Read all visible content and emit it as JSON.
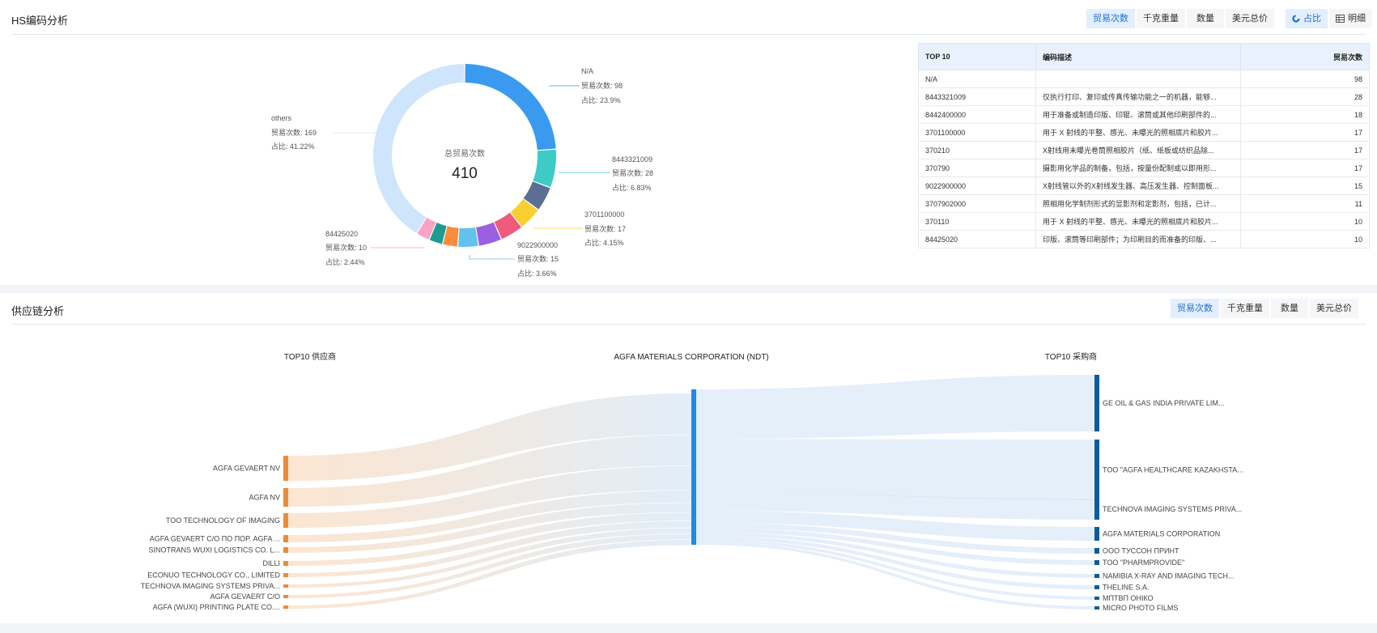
{
  "hs_section": {
    "title": "HS编码分析",
    "metric_buttons": [
      "贸易次数",
      "千克重量",
      "数量",
      "美元总价"
    ],
    "view_buttons": [
      "占比",
      "明细"
    ],
    "donut_center": {
      "label": "总贸易次数",
      "value": "410"
    },
    "donut_labels": [
      {
        "code": "N/A",
        "count": "贸易次数: 98",
        "pct": "占比: 23.9%"
      },
      {
        "code": "8443321009",
        "count": "贸易次数: 28",
        "pct": "占比: 6.83%"
      },
      {
        "code": "3701100000",
        "count": "贸易次数: 17",
        "pct": "占比: 4.15%"
      },
      {
        "code": "9022900000",
        "count": "贸易次数: 15",
        "pct": "占比: 3.66%"
      },
      {
        "code": "84425020",
        "count": "贸易次数: 10",
        "pct": "占比: 2.44%"
      },
      {
        "code": "others",
        "count": "贸易次数: 169",
        "pct": "占比: 41.22%"
      }
    ],
    "table": {
      "headers": [
        "TOP 10",
        "编码描述",
        "贸易次数"
      ],
      "rows": [
        [
          "N/A",
          "",
          "98"
        ],
        [
          "8443321009",
          "仅执行打印、复印或传真传输功能之一的机器，能够...",
          "28"
        ],
        [
          "8442400000",
          "用于准备或制造印版、印辊、滚筒或其他印刷部件的...",
          "18"
        ],
        [
          "3701100000",
          "用于 X 射线的平整、感光、未曝光的照相底片和胶片...",
          "17"
        ],
        [
          "370210",
          "X射线用未曝光卷筒照相胶片（纸、纸板或纺织品除...",
          "17"
        ],
        [
          "370790",
          "摄影用化学品的制备，包括，按量份配制或以即用形...",
          "17"
        ],
        [
          "9022900000",
          "X射线管以外的X射线发生器、高压发生器、控制面板...",
          "15"
        ],
        [
          "3707902000",
          "照相用化学制剂形式的显影剂和定影剂，包括，已计...",
          "11"
        ],
        [
          "370110",
          "用于 X 射线的平整、感光、未曝光的照相底片和胶片...",
          "10"
        ],
        [
          "84425020",
          "印版、滚筒等印刷部件；为印刷目的而准备的印版、...",
          "10"
        ]
      ]
    }
  },
  "supply_section": {
    "title": "供应链分析",
    "metric_buttons": [
      "贸易次数",
      "千克重量",
      "数量",
      "美元总价"
    ],
    "col_suppliers": "TOP10 供应商",
    "col_center": "AGFA MATERIALS CORPORATION (NDT)",
    "col_buyers": "TOP10 采购商",
    "suppliers": [
      "AGFA GEVAERT NV",
      "AGFA NV",
      "TOO TECHNOLOGY OF IMAGING",
      "AGFA GEVAERT C/O ПО ПОР. AGFA ...",
      "SINOTRANS WUXI LOGISTICS CO. L...",
      "DILLI",
      "ECONUO TECHNOLOGY CO., LIMITED",
      "TECHNOVA IMAGING SYSTEMS PRIVA...",
      "AGFA GEVAERT C/O",
      "AGFA (WUXI) PRINTING PLATE CO...."
    ],
    "buyers": [
      "GE OIL & GAS INDIA PRIVATE LIM...",
      "TOO \"AGFA HEALTHCARE KAZAKHSTA...",
      "TECHNOVA IMAGING SYSTEMS PRIVA...",
      "AGFA MATERIALS CORPORATION",
      "ООО ТУССОН ПРИНТ",
      "TOO \"PHARMPROVIDE\"",
      "NAMIBIA X-RAY AND IMAGING TECH...",
      "THELINE S.A.",
      "МПТВП ОНІКО",
      "MICRO PHOTO FILMS"
    ]
  },
  "chart_data": {
    "type": "pie",
    "title": "总贸易次数",
    "total": 410,
    "slices": [
      {
        "label": "N/A",
        "value": 98,
        "color": "#3a9af0"
      },
      {
        "label": "8443321009",
        "value": 28,
        "color": "#3ccbc5"
      },
      {
        "label": "8442400000",
        "value": 18,
        "color": "#5b6f95"
      },
      {
        "label": "3701100000",
        "value": 17,
        "color": "#f9cf2f"
      },
      {
        "label": "370210",
        "value": 17,
        "color": "#ef5b7a"
      },
      {
        "label": "370790",
        "value": 17,
        "color": "#9b5fe0"
      },
      {
        "label": "9022900000",
        "value": 15,
        "color": "#61c2ee"
      },
      {
        "label": "3707902000",
        "value": 11,
        "color": "#fa8c3c"
      },
      {
        "label": "370110",
        "value": 10,
        "color": "#1e9c94"
      },
      {
        "label": "84425020",
        "value": 10,
        "color": "#f8a3c6"
      },
      {
        "label": "others",
        "value": 169,
        "color": "#cfe5fb"
      }
    ]
  }
}
